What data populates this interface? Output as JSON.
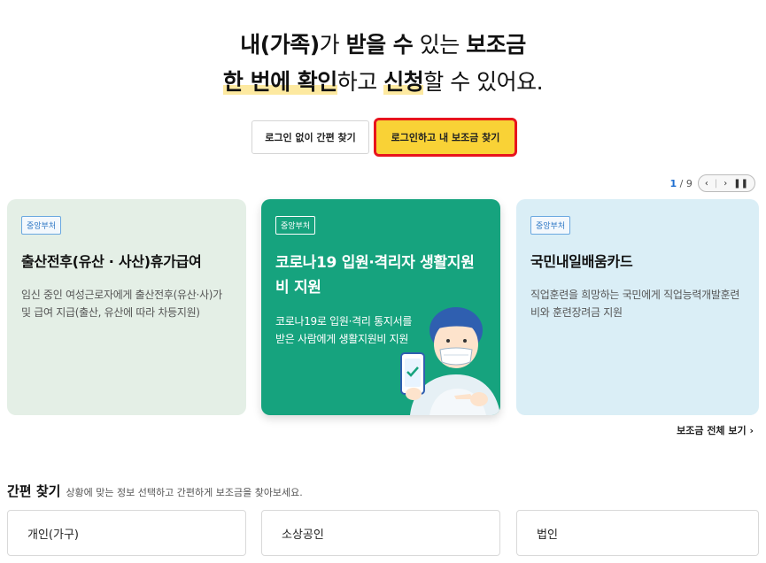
{
  "hero": {
    "line1_a": "내(가족)",
    "line1_b": "가 ",
    "line1_c": "받을 수",
    "line1_d": " 있는 ",
    "line1_e": "보조금",
    "line2_a": "한 번에 확인",
    "line2_b": "하고 ",
    "line2_c": "신청",
    "line2_d": "할 수 있어요."
  },
  "buttons": {
    "guest_search": "로그인 없이 간편 찾기",
    "login_search": "로그인하고 내 보조금 찾기"
  },
  "pager": {
    "current": "1",
    "total": "/ 9",
    "prev": "‹",
    "next": "›",
    "pause": "❚❚"
  },
  "cards": [
    {
      "badge": "중앙부처",
      "title": "출산전후(유산 · 사산)휴가급여",
      "desc": "임신 중인 여성근로자에게 출산전후(유산·사)가 및 급여 지급(출산, 유산에 따라 차등지원)"
    },
    {
      "badge": "중앙부처",
      "title": "코로나19 입원·격리자 생활지원비 지원",
      "desc": "코로나19로 입원·격리 통지서를 받은 사람에게 생활지원비 지원"
    },
    {
      "badge": "중앙부처",
      "title": "국민내일배움카드",
      "desc": "직업훈련을 희망하는 국민에게 직업능력개발훈련비와 훈련장려금 지원"
    }
  ],
  "all_link": "보조금 전체 보기 ›",
  "quick": {
    "title": "간편 찾기",
    "subtitle": "상황에 맞는 정보 선택하고 간편하게 보조금을 찾아보세요.",
    "options": [
      "개인(가구)",
      "소상공인",
      "법인"
    ]
  },
  "colors": {
    "accent_yellow": "#f9d236",
    "highlight": "#fde9a0",
    "card_green": "#16a37e",
    "card_mint": "#e4efe6",
    "card_sky": "#daeef6",
    "focus_red": "#e8141d"
  },
  "icons": {
    "illustration": "person-with-mask-holding-phone-icon"
  }
}
